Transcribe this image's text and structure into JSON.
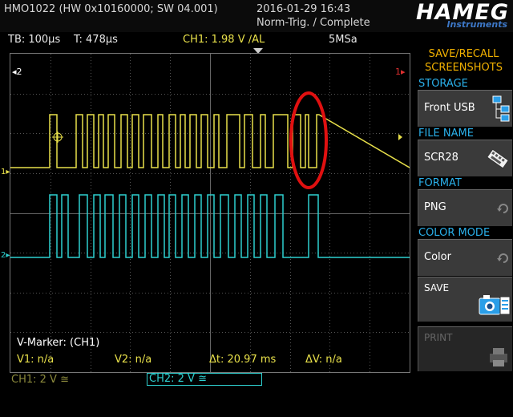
{
  "header": {
    "model": "HMO1022 (HW 0x10160000; SW 04.001)",
    "datetime": "2016-01-29 16:43",
    "status": "Norm-Trig. / Complete",
    "logo_main": "HAMEG",
    "logo_sub": "Instruments"
  },
  "acquisition": {
    "timebase": "TB: 100µs",
    "trigger_time": "T: 478µs",
    "ch1_trigger": "CH1: 1.98 V ∕AL",
    "sample_rate": "5MSa"
  },
  "markers": {
    "ch2_ref": "2",
    "ch1_ref": "1",
    "trigger_pos": "1",
    "ch1_left": "1",
    "ch2_left": "2"
  },
  "vmarker": {
    "title": "V-Marker: (CH1)",
    "v1": "V1: n/a",
    "v2": "V2: n/a",
    "dt": "Δt: 20.97 ms",
    "dv": "ΔV: n/a"
  },
  "channels": {
    "ch1": "CH1: 2 V ≅",
    "ch2": "CH2: 2 V ≅"
  },
  "side_menu": {
    "title_line1": "SAVE/RECALL",
    "title_line2": "SCREENSHOTS",
    "storage_label": "STORAGE",
    "storage_value": "Front USB",
    "filename_label": "FILE NAME",
    "filename_value": "SCR28",
    "format_label": "FORMAT",
    "format_value": "PNG",
    "colormode_label": "COLOR MODE",
    "colormode_value": "Color",
    "save_label": "SAVE",
    "print_label": "PRINT"
  },
  "colors": {
    "ch1": "#e8e04a",
    "ch2": "#2ecfcf",
    "highlight": "#e01010",
    "menu_accent": "#2ab0ea",
    "title_accent": "#f0b000"
  }
}
